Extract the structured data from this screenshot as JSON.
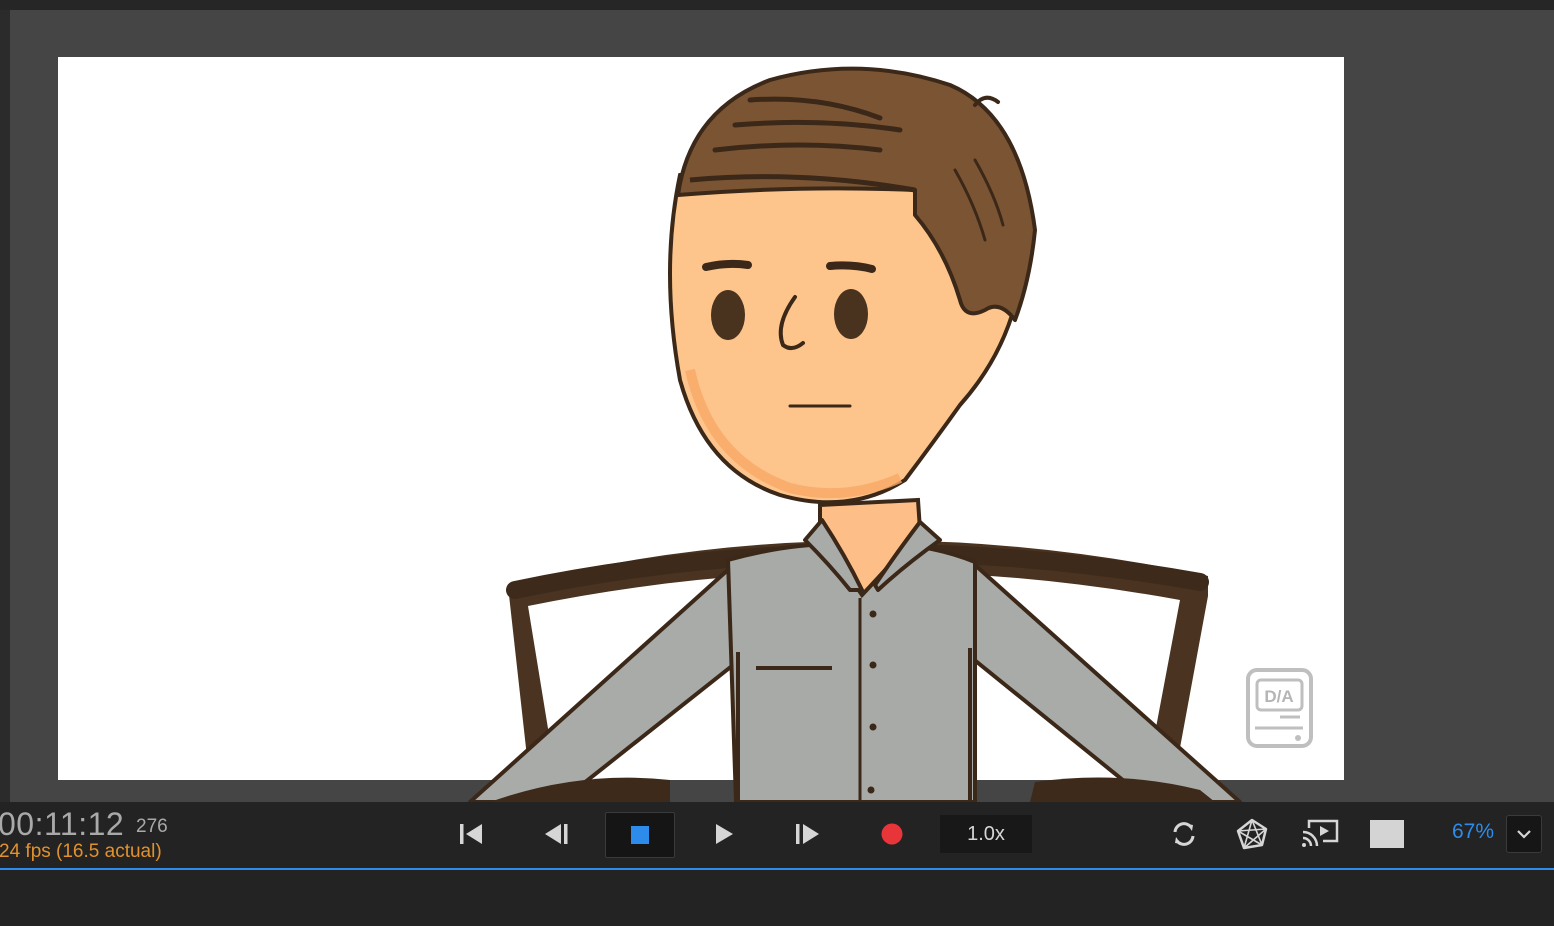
{
  "playback": {
    "timecode": "00:11:12",
    "frame": "276",
    "fps": "24 fps (16.5 actual)",
    "speed": "1.0x",
    "zoom": "67%"
  },
  "canvas": {
    "watermark_text": "D/A"
  },
  "icons": {
    "first_frame": "skip-to-start-icon",
    "step_back": "step-back-icon",
    "stop": "stop-icon",
    "play": "play-icon",
    "step_forward": "step-forward-icon",
    "record": "record-icon",
    "loop": "loop-icon",
    "onion_skin": "onion-skin-icon",
    "cast": "cast-icon",
    "background": "background-color-icon",
    "zoom_menu": "chevron-down-icon"
  },
  "colors": {
    "accent": "#2d8ceb",
    "fps_text": "#e2912d",
    "record": "#e8353a",
    "stop": "#2d8ceb"
  }
}
